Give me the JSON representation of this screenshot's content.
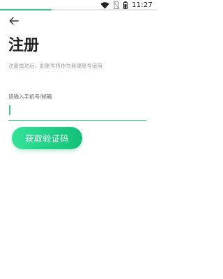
{
  "status_bar": {
    "time": "11:27",
    "icons": [
      "wifi-icon",
      "no-sim-icon",
      "battery-icon"
    ],
    "progress": 0.33
  },
  "header": {
    "back_icon": "arrow-left-icon"
  },
  "main": {
    "title": "注册",
    "subtitle": "注册成功后，此账号将作为登录账号使用",
    "input_label": "请输入手机号/邮箱",
    "input_value": "",
    "input_placeholder": "",
    "button_label": "获取验证码"
  },
  "colors": {
    "accent": "#2fcf86",
    "button_gradient_start": "#34e29a",
    "button_gradient_end": "#12c077",
    "title": "#222222",
    "subtitle": "#9a9a9a"
  }
}
